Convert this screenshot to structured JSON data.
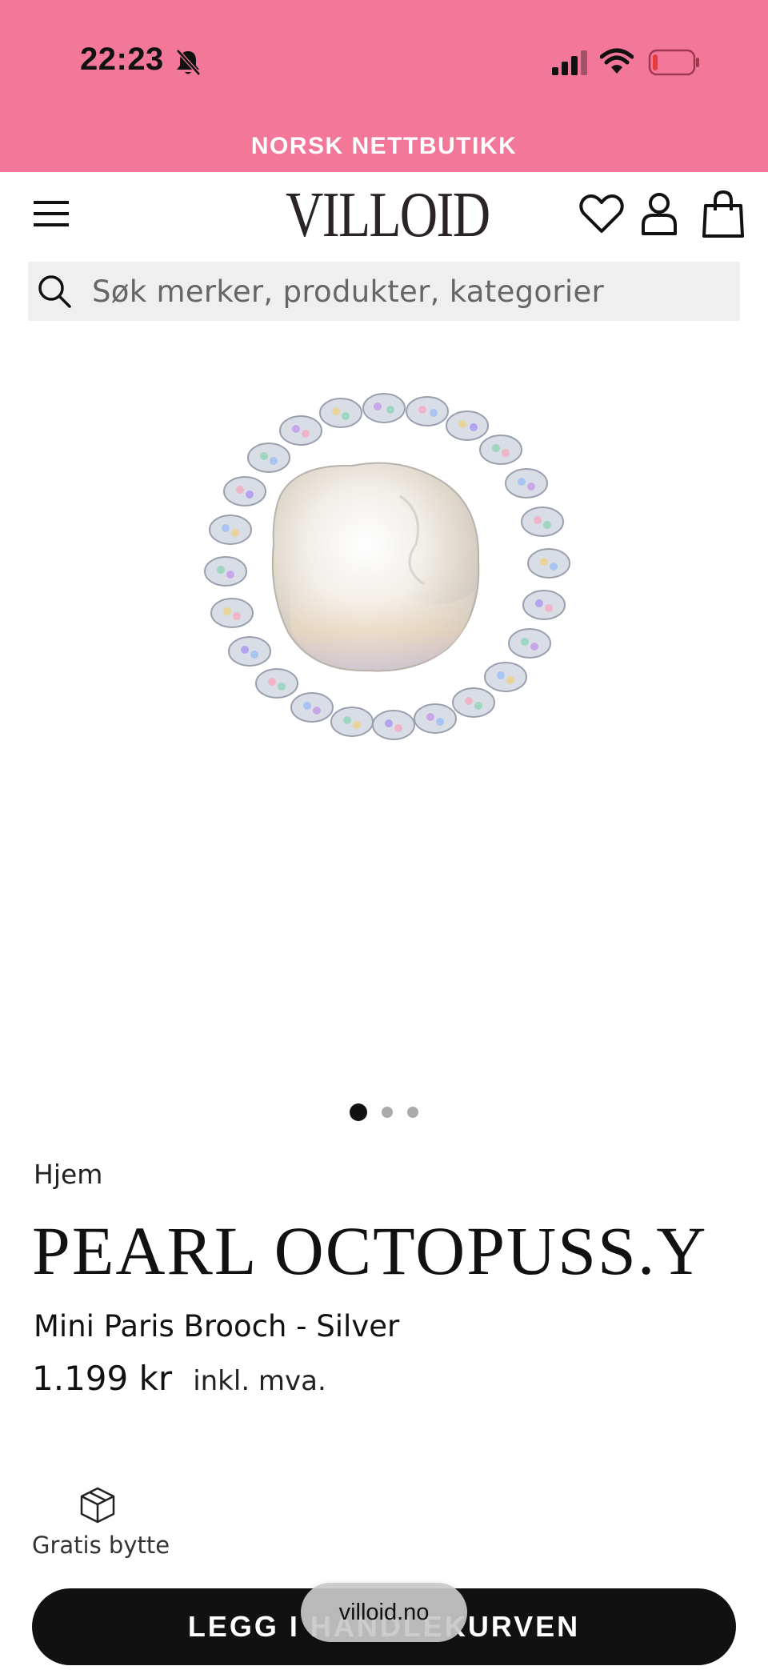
{
  "status_bar": {
    "time": "22:23",
    "icons": [
      "bell-muted-icon",
      "cellular-signal-icon",
      "wifi-icon",
      "battery-low-icon"
    ]
  },
  "banner": {
    "text": "NORSK NETTBUTIKK",
    "background": "#f27799"
  },
  "header": {
    "logo": "VILLOID",
    "icons": [
      "hamburger-menu-icon",
      "heart-icon",
      "user-icon",
      "shopping-bag-icon"
    ]
  },
  "search": {
    "placeholder": "Søk merker, produkter, kategorier",
    "value": ""
  },
  "gallery": {
    "image": "pearl-brooch-image",
    "dots_total": 3,
    "active_index": 0
  },
  "breadcrumb": "Hjem",
  "product": {
    "brand": "PEARL OCTOPUSS.Y",
    "name": "Mini Paris Brooch - Silver",
    "price": "1.199 kr",
    "vat_note": "inkl. mva."
  },
  "features": [
    {
      "icon": "box-icon",
      "label": "Gratis bytte"
    }
  ],
  "cart_button": {
    "label": "LEGG I HANDLEKURVEN"
  },
  "browser": {
    "url": "villoid.no"
  }
}
